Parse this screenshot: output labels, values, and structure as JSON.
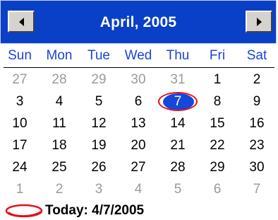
{
  "header": {
    "title": "April, 2005",
    "prev_icon": "triangle-left-icon",
    "next_icon": "triangle-right-icon",
    "bg_color": "#0a3fc8"
  },
  "weekdays": [
    "Sun",
    "Mon",
    "Tue",
    "Wed",
    "Thu",
    "Fri",
    "Sat"
  ],
  "weeks": [
    [
      {
        "d": "27",
        "other": true
      },
      {
        "d": "28",
        "other": true
      },
      {
        "d": "29",
        "other": true
      },
      {
        "d": "30",
        "other": true
      },
      {
        "d": "31",
        "other": true
      },
      {
        "d": "1",
        "other": false
      },
      {
        "d": "2",
        "other": false
      }
    ],
    [
      {
        "d": "3",
        "other": false
      },
      {
        "d": "4",
        "other": false
      },
      {
        "d": "5",
        "other": false
      },
      {
        "d": "6",
        "other": false
      },
      {
        "d": "7",
        "other": false,
        "selected": true
      },
      {
        "d": "8",
        "other": false
      },
      {
        "d": "9",
        "other": false
      }
    ],
    [
      {
        "d": "10",
        "other": false
      },
      {
        "d": "11",
        "other": false
      },
      {
        "d": "12",
        "other": false
      },
      {
        "d": "13",
        "other": false
      },
      {
        "d": "14",
        "other": false
      },
      {
        "d": "15",
        "other": false
      },
      {
        "d": "16",
        "other": false
      }
    ],
    [
      {
        "d": "17",
        "other": false
      },
      {
        "d": "18",
        "other": false
      },
      {
        "d": "19",
        "other": false
      },
      {
        "d": "20",
        "other": false
      },
      {
        "d": "21",
        "other": false
      },
      {
        "d": "22",
        "other": false
      },
      {
        "d": "23",
        "other": false
      }
    ],
    [
      {
        "d": "24",
        "other": false
      },
      {
        "d": "25",
        "other": false
      },
      {
        "d": "26",
        "other": false
      },
      {
        "d": "27",
        "other": false
      },
      {
        "d": "28",
        "other": false
      },
      {
        "d": "29",
        "other": false
      },
      {
        "d": "30",
        "other": false
      }
    ],
    [
      {
        "d": "1",
        "other": true
      },
      {
        "d": "2",
        "other": true
      },
      {
        "d": "3",
        "other": true
      },
      {
        "d": "4",
        "other": true
      },
      {
        "d": "5",
        "other": true
      },
      {
        "d": "6",
        "other": true
      },
      {
        "d": "7",
        "other": true
      }
    ]
  ],
  "today": {
    "label": "Today: 4/7/2005"
  },
  "colors": {
    "weekday_text": "#1a44d6",
    "selected_fill": "#1547d8",
    "today_ring": "#e3121b",
    "other_month_text": "#9a9a9a"
  }
}
